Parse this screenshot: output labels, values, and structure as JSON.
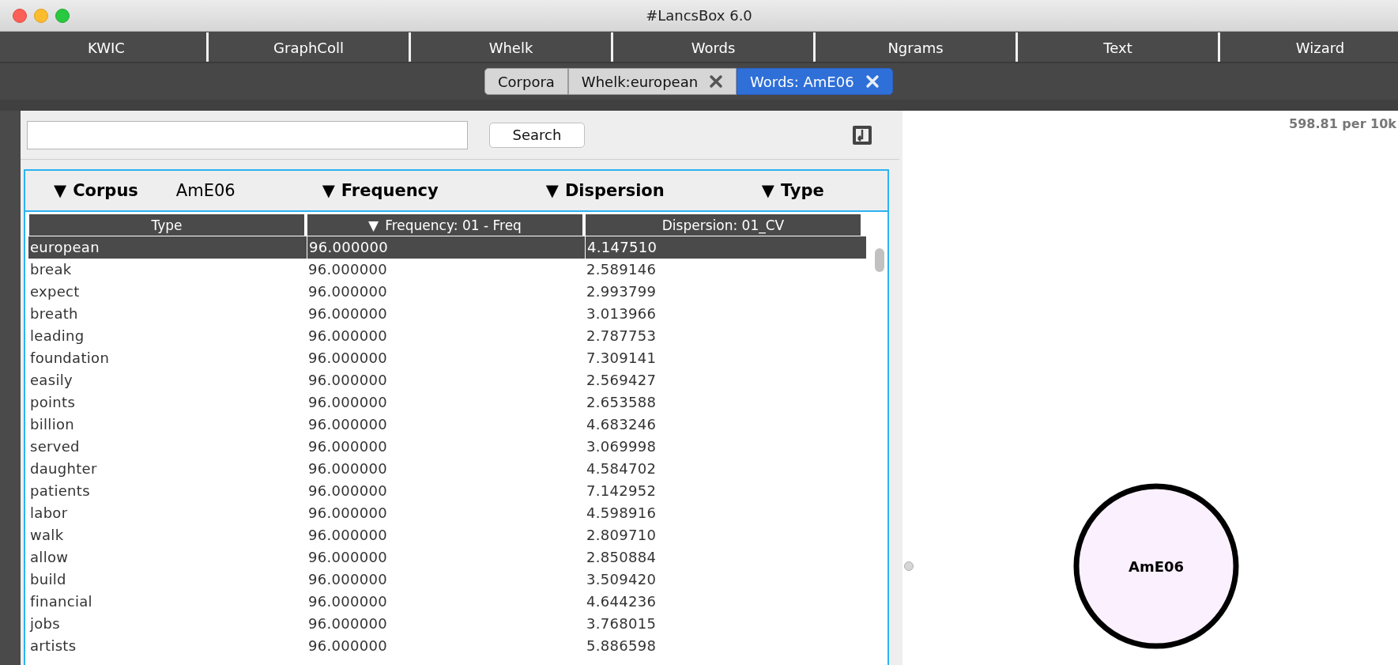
{
  "window": {
    "title": "#LancsBox 6.0"
  },
  "menu": [
    "KWIC",
    "GraphColl",
    "Whelk",
    "Words",
    "Ngrams",
    "Text",
    "Wizard"
  ],
  "tabs": [
    {
      "label": "Corpora",
      "selected": false,
      "closable": false
    },
    {
      "label": "Whelk:european",
      "selected": false,
      "closable": true
    },
    {
      "label": "Words: AmE06",
      "selected": true,
      "closable": true
    }
  ],
  "search": {
    "button": "Search"
  },
  "filters": [
    {
      "arrow": "▼",
      "label": "Corpus",
      "value": "AmE06"
    },
    {
      "arrow": "▼",
      "label": "Frequency"
    },
    {
      "arrow": "▼",
      "label": "Dispersion"
    },
    {
      "arrow": "▼",
      "label": "Type"
    }
  ],
  "table": {
    "columns": [
      {
        "label": "Type"
      },
      {
        "label": "Frequency: 01 - Freq",
        "sort": "▼"
      },
      {
        "label": "Dispersion: 01_CV"
      }
    ],
    "rows": [
      {
        "cells": [
          "european",
          "96.000000",
          "4.147510"
        ],
        "selected": true
      },
      {
        "cells": [
          "break",
          "96.000000",
          "2.589146"
        ],
        "selected": false
      },
      {
        "cells": [
          "expect",
          "96.000000",
          "2.993799"
        ],
        "selected": false
      },
      {
        "cells": [
          "breath",
          "96.000000",
          "3.013966"
        ],
        "selected": false
      },
      {
        "cells": [
          "leading",
          "96.000000",
          "2.787753"
        ],
        "selected": false
      },
      {
        "cells": [
          "foundation",
          "96.000000",
          "7.309141"
        ],
        "selected": false
      },
      {
        "cells": [
          "easily",
          "96.000000",
          "2.569427"
        ],
        "selected": false
      },
      {
        "cells": [
          "points",
          "96.000000",
          "2.653588"
        ],
        "selected": false
      },
      {
        "cells": [
          "billion",
          "96.000000",
          "4.683246"
        ],
        "selected": false
      },
      {
        "cells": [
          "served",
          "96.000000",
          "3.069998"
        ],
        "selected": false
      },
      {
        "cells": [
          "daughter",
          "96.000000",
          "4.584702"
        ],
        "selected": false
      },
      {
        "cells": [
          "patients",
          "96.000000",
          "7.142952"
        ],
        "selected": false
      },
      {
        "cells": [
          "labor",
          "96.000000",
          "4.598916"
        ],
        "selected": false
      },
      {
        "cells": [
          "walk",
          "96.000000",
          "2.809710"
        ],
        "selected": false
      },
      {
        "cells": [
          "allow",
          "96.000000",
          "2.850884"
        ],
        "selected": false
      },
      {
        "cells": [
          "build",
          "96.000000",
          "3.509420"
        ],
        "selected": false
      },
      {
        "cells": [
          "financial",
          "96.000000",
          "4.644236"
        ],
        "selected": false
      },
      {
        "cells": [
          "jobs",
          "96.000000",
          "3.768015"
        ],
        "selected": false
      },
      {
        "cells": [
          "artists",
          "96.000000",
          "5.886598"
        ],
        "selected": false
      }
    ]
  },
  "graph": {
    "scale_note": "598.81 per 10k",
    "node": "AmE06"
  }
}
